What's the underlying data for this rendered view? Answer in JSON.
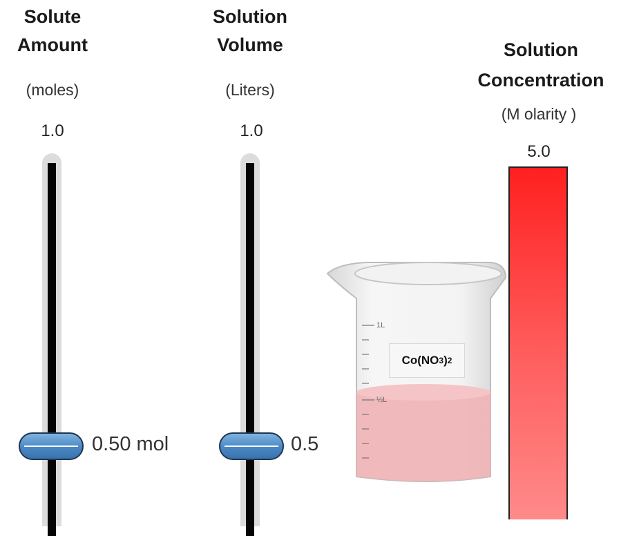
{
  "solute": {
    "heading_line1": "Solute",
    "heading_line2": "Amount",
    "units": "(moles)",
    "max": "1.0",
    "value_label": "0.50 mol",
    "value": 0.5
  },
  "volume": {
    "heading_line1": "Solution",
    "heading_line2": "Volume",
    "units": "(Liters)",
    "max": "1.0",
    "value_label": "0.5",
    "value": 0.5
  },
  "concentration": {
    "heading_line1": "Solution",
    "heading_line2": "Concentration",
    "units": "(M olarity )",
    "max": "5.0",
    "fill_fraction": 1.0,
    "colors": {
      "top": "#ff2020",
      "bottom": "#ff8a8a"
    }
  },
  "beaker": {
    "formula_main": "Co(NO",
    "formula_sub1": "3",
    "formula_close": ")",
    "formula_sub2": "2",
    "mark_1L": "1L",
    "mark_half": "½L",
    "solution_color": "#f0b3b6",
    "fill_fraction": 0.5
  },
  "icons": {
    "slider_thumb": "pill-slider-thumb",
    "beaker": "beaker-icon"
  }
}
